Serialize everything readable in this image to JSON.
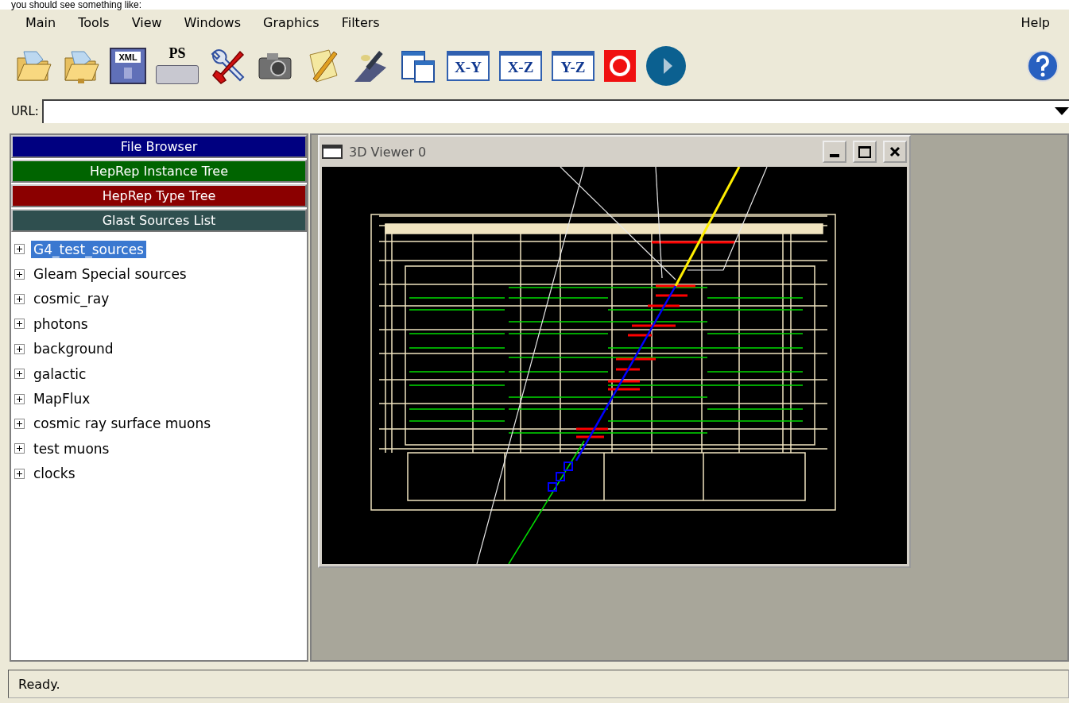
{
  "caption": "you should see something like:",
  "menu": {
    "left": [
      "Main",
      "Tools",
      "View",
      "Windows",
      "Graphics",
      "Filters"
    ],
    "right": "Help"
  },
  "toolbar": [
    {
      "kind": "open-folder"
    },
    {
      "kind": "network-folder"
    },
    {
      "kind": "floppy",
      "label": "XML"
    },
    {
      "kind": "printer",
      "label": "PS"
    },
    {
      "kind": "tools"
    },
    {
      "kind": "camera"
    },
    {
      "kind": "notepad"
    },
    {
      "kind": "satellite"
    },
    {
      "kind": "windows"
    },
    {
      "kind": "view",
      "label": "X-Y"
    },
    {
      "kind": "view",
      "label": "X-Z"
    },
    {
      "kind": "view",
      "label": "Y-Z"
    },
    {
      "kind": "stop"
    },
    {
      "kind": "play"
    },
    {
      "kind": "help"
    }
  ],
  "url": {
    "label": "URL:"
  },
  "panels": [
    {
      "label": "File Browser",
      "color": "#000080"
    },
    {
      "label": "HepRep Instance Tree",
      "color": "#006400"
    },
    {
      "label": "HepRep Type Tree",
      "color": "#8b0000"
    },
    {
      "label": "Glast Sources List",
      "color": "#2f4f4f"
    }
  ],
  "tree": [
    {
      "label": "G4_test_sources",
      "expanded": false,
      "selected": true
    },
    {
      "label": "Gleam Special sources",
      "expanded": false,
      "selected": false
    },
    {
      "label": "cosmic_ray",
      "expanded": false,
      "selected": false
    },
    {
      "label": "photons",
      "expanded": false,
      "selected": false
    },
    {
      "label": "background",
      "expanded": false,
      "selected": false
    },
    {
      "label": "galactic",
      "expanded": false,
      "selected": false
    },
    {
      "label": "MapFlux",
      "expanded": false,
      "selected": false
    },
    {
      "label": "cosmic ray surface muons",
      "expanded": false,
      "selected": false
    },
    {
      "label": "test muons",
      "expanded": false,
      "selected": false
    },
    {
      "label": "clocks",
      "expanded": false,
      "selected": false
    }
  ],
  "viewer": {
    "title": "3D Viewer 0"
  },
  "status_bar": "Ready."
}
